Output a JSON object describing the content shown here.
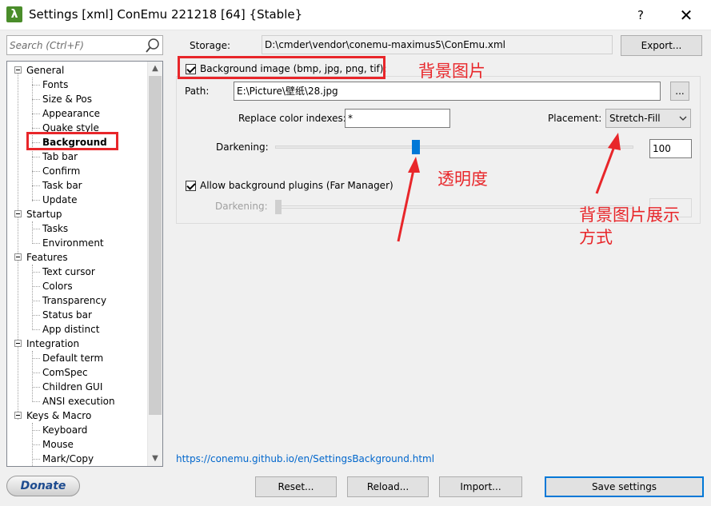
{
  "window": {
    "title": "Settings [xml] ConEmu 221218 [64] {Stable}",
    "help_label": "?",
    "close_label": "✕",
    "app_icon_glyph": "λ"
  },
  "search": {
    "placeholder": "Search (Ctrl+F)"
  },
  "tree": {
    "general": {
      "label": "General",
      "children": [
        "Fonts",
        "Size & Pos",
        "Appearance",
        "Quake style",
        "Background",
        "Tab bar",
        "Confirm",
        "Task bar",
        "Update"
      ]
    },
    "startup": {
      "label": "Startup",
      "children": [
        "Tasks",
        "Environment"
      ]
    },
    "features": {
      "label": "Features",
      "children": [
        "Text cursor",
        "Colors",
        "Transparency",
        "Status bar",
        "App distinct"
      ]
    },
    "integration": {
      "label": "Integration",
      "children": [
        "Default term",
        "ComSpec",
        "Children GUI",
        "ANSI execution"
      ]
    },
    "keys": {
      "label": "Keys & Macro",
      "children": [
        "Keyboard",
        "Mouse",
        "Mark/Copy"
      ]
    },
    "selected": "Background"
  },
  "settings": {
    "storage_label": "Storage:",
    "storage_path": "D:\\cmder\\vendor\\conemu-maximus5\\ConEmu.xml",
    "export_button": "Export...",
    "bg_image_label": "Background image (bmp, jpg, png, tif):",
    "bg_image_checked": true,
    "path_label": "Path:",
    "path_value": "E:\\Picture\\壁纸\\28.jpg",
    "browse_button": "...",
    "replace_label": "Replace color indexes:",
    "replace_value": "*",
    "placement_label": "Placement:",
    "placement_value": "Stretch-Fill",
    "darkening_label": "Darkening:",
    "darkening_value": "100",
    "plugins_label": "Allow background plugins (Far Manager)",
    "plugins_checked": true,
    "darkening2_label": "Darkening:"
  },
  "annotations": {
    "bg_image": "背景图片",
    "opacity": "透明度",
    "placement_line1": "背景图片展示",
    "placement_line2": "方式"
  },
  "footer": {
    "link": "https://conemu.github.io/en/SettingsBackground.html",
    "donate": "Donate",
    "reset": "Reset...",
    "reload": "Reload...",
    "import": "Import...",
    "save": "Save settings"
  },
  "colors": {
    "annotation_red": "#e8262a",
    "accent_blue": "#0078d7",
    "link_blue": "#0066cc"
  }
}
